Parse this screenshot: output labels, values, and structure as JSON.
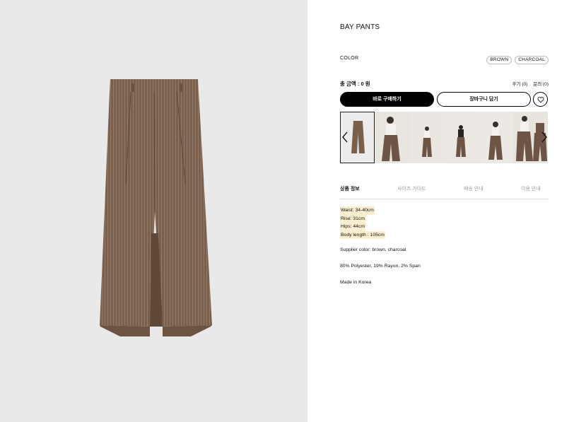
{
  "product": {
    "title": "BAY PANTS",
    "image_alt": "brown pinstripe wide pants"
  },
  "color": {
    "label": "COLOR",
    "options": [
      "BROWN",
      "CHARCOAL"
    ]
  },
  "price": {
    "total": "총 금액 : 0 원"
  },
  "links": {
    "reviews": "후기 (0)",
    "qna": "문의 (0)"
  },
  "buttons": {
    "buy_now": "바로 구매하기",
    "add_cart": "장바구니 담기"
  },
  "tabs": [
    "상품 정보",
    "사이즈 가이드",
    "배송 안내",
    "이용 안내"
  ],
  "details": {
    "measurements": [
      "Waist: 34-40cm",
      "Rise: 31cm",
      "Hips: 44cm",
      "Body length : 105cm"
    ],
    "supplier_color": "Supplier color: brown, charcoal",
    "fabric": "80% Polyester, 19% Rayon, 2% Span",
    "origin": "Made in Korea"
  },
  "colors": {
    "hero_bg": "#e9e9e9",
    "pants_brown": "#7a5f4c",
    "highlight": "#fbeed0",
    "accent": "#000000"
  }
}
